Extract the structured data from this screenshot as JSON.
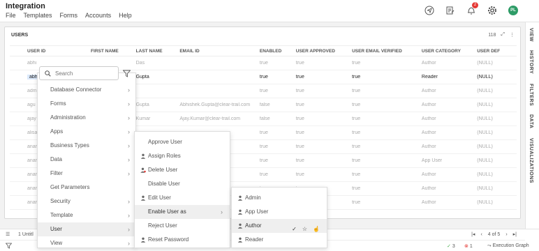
{
  "app": {
    "title": "Integration",
    "menu": [
      "File",
      "Templates",
      "Forms",
      "Accounts",
      "Help"
    ],
    "notification_count": "2",
    "avatar_initials": "PL"
  },
  "panel": {
    "title": "USERS",
    "count": "118"
  },
  "grid": {
    "columns": [
      "USER ID",
      "FIRST NAME",
      "LAST NAME",
      "EMAIL ID",
      "ENABLED",
      "USER APPROVED",
      "USER EMAIL VERIFIED",
      "USER CATEGORY",
      "USER DEF"
    ],
    "rows": [
      [
        "abhi",
        "",
        "Das",
        "",
        "true",
        "true",
        "true",
        "Author",
        "(NULL)"
      ],
      [
        "abhi",
        "",
        "Gupta",
        "",
        "true",
        "true",
        "true",
        "Reader",
        "(NULL)"
      ],
      [
        "adm",
        "",
        "",
        "",
        "true",
        "true",
        "true",
        "Author",
        "(NULL)"
      ],
      [
        "agu",
        "",
        "Gupta",
        "Abhishek.Gupta@clear-trail.com",
        "false",
        "true",
        "true",
        "Author",
        "(NULL)"
      ],
      [
        "ajay",
        "",
        "Kumar",
        "Ajay.Kumar@clear-trail.com",
        "false",
        "true",
        "true",
        "Author",
        "(NULL)"
      ],
      [
        "alisa",
        "",
        "",
        "com",
        "true",
        "true",
        "true",
        "Author",
        "(NULL)"
      ],
      [
        "anar",
        "",
        "",
        "a.io",
        "true",
        "true",
        "true",
        "Author",
        "(NULL)"
      ],
      [
        "anar",
        "",
        "",
        "",
        "true",
        "true",
        "true",
        "App User",
        "(NULL)"
      ],
      [
        "anar",
        "",
        "",
        "ra.io",
        "true",
        "true",
        "true",
        "Author",
        "(NULL)"
      ],
      [
        "anar",
        "",
        "",
        "",
        "true",
        "true",
        "true",
        "Author",
        "(NULL)"
      ],
      [
        "anar",
        "",
        "",
        "",
        "true",
        "true",
        "true",
        "Author",
        "(NULL)"
      ]
    ]
  },
  "rail": [
    "VIEW",
    "HISTORY",
    "FILTERS",
    "DATA",
    "VISUALIZATIONS"
  ],
  "bottom": {
    "tab": "1 Untitl",
    "page": "4 of 5",
    "ok_count": "3",
    "err_count": "1",
    "exec_label": "Execution Graph"
  },
  "search": {
    "placeholder": "Search"
  },
  "menu1": {
    "items": [
      "Database Connector",
      "Forms",
      "Administration",
      "Apps",
      "Business Types",
      "Data",
      "Filter",
      "Get Parameters",
      "Security",
      "Template",
      "User",
      "View"
    ]
  },
  "menu2": {
    "items": [
      "Approve User",
      "Assign Roles",
      "Delete User",
      "Disable User",
      "Edit User",
      "Enable User as",
      "Reject User",
      "Reset Password"
    ]
  },
  "menu3": {
    "items": [
      "Admin",
      "App User",
      "Author",
      "Reader"
    ]
  }
}
